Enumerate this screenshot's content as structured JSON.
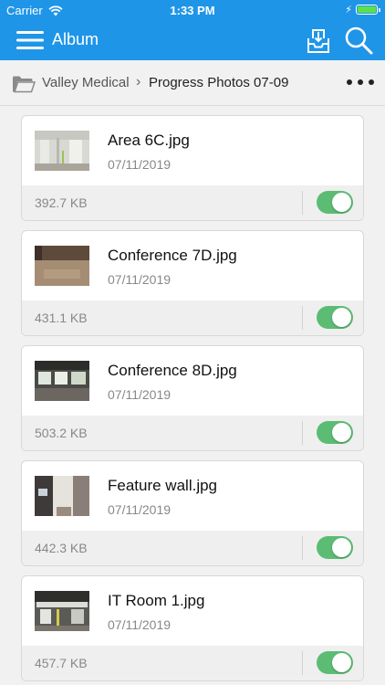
{
  "status_bar": {
    "carrier": "Carrier",
    "time": "1:33 PM",
    "battery_color": "#5be24a"
  },
  "nav": {
    "title": "Album",
    "bar_color": "#1f95e8",
    "icons": [
      "hamburger-menu-icon",
      "inbox-download-icon",
      "search-icon"
    ]
  },
  "breadcrumb": {
    "root": "Valley Medical",
    "separator": "›",
    "current": "Progress Photos 07-09"
  },
  "photos": [
    {
      "name": "Area 6C.jpg",
      "date": "07/11/2019",
      "size": "392.7 KB",
      "enabled": true
    },
    {
      "name": "Conference 7D.jpg",
      "date": "07/11/2019",
      "size": "431.1 KB",
      "enabled": true
    },
    {
      "name": "Conference 8D.jpg",
      "date": "07/11/2019",
      "size": "503.2 KB",
      "enabled": true
    },
    {
      "name": "Feature wall.jpg",
      "date": "07/11/2019",
      "size": "442.3 KB",
      "enabled": true
    },
    {
      "name": "IT Room 1.jpg",
      "date": "07/11/2019",
      "size": "457.7 KB",
      "enabled": true
    }
  ],
  "toggle_on_color": "#5cbc74"
}
